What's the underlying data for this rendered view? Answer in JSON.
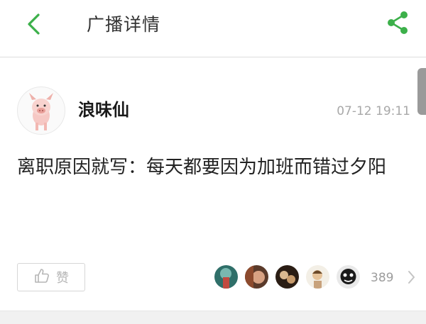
{
  "header": {
    "title": "广播详情",
    "back_icon": "chevron-left-icon",
    "share_icon": "share-icon",
    "accent_color": "#3cb04a"
  },
  "post": {
    "author": "浪味仙",
    "avatar_icon": "pig-avatar",
    "time": "07-12 19:11",
    "text": "离职原因就写：每天都要因为加班而错过夕阳"
  },
  "actions": {
    "like_label": "赞",
    "like_icon": "thumbs-up-icon",
    "like_count": "389",
    "likers": [
      {
        "name": "liker-avatar-1"
      },
      {
        "name": "liker-avatar-2"
      },
      {
        "name": "liker-avatar-3"
      },
      {
        "name": "liker-avatar-4"
      },
      {
        "name": "liker-avatar-5"
      }
    ],
    "more_icon": "chevron-right-icon"
  }
}
